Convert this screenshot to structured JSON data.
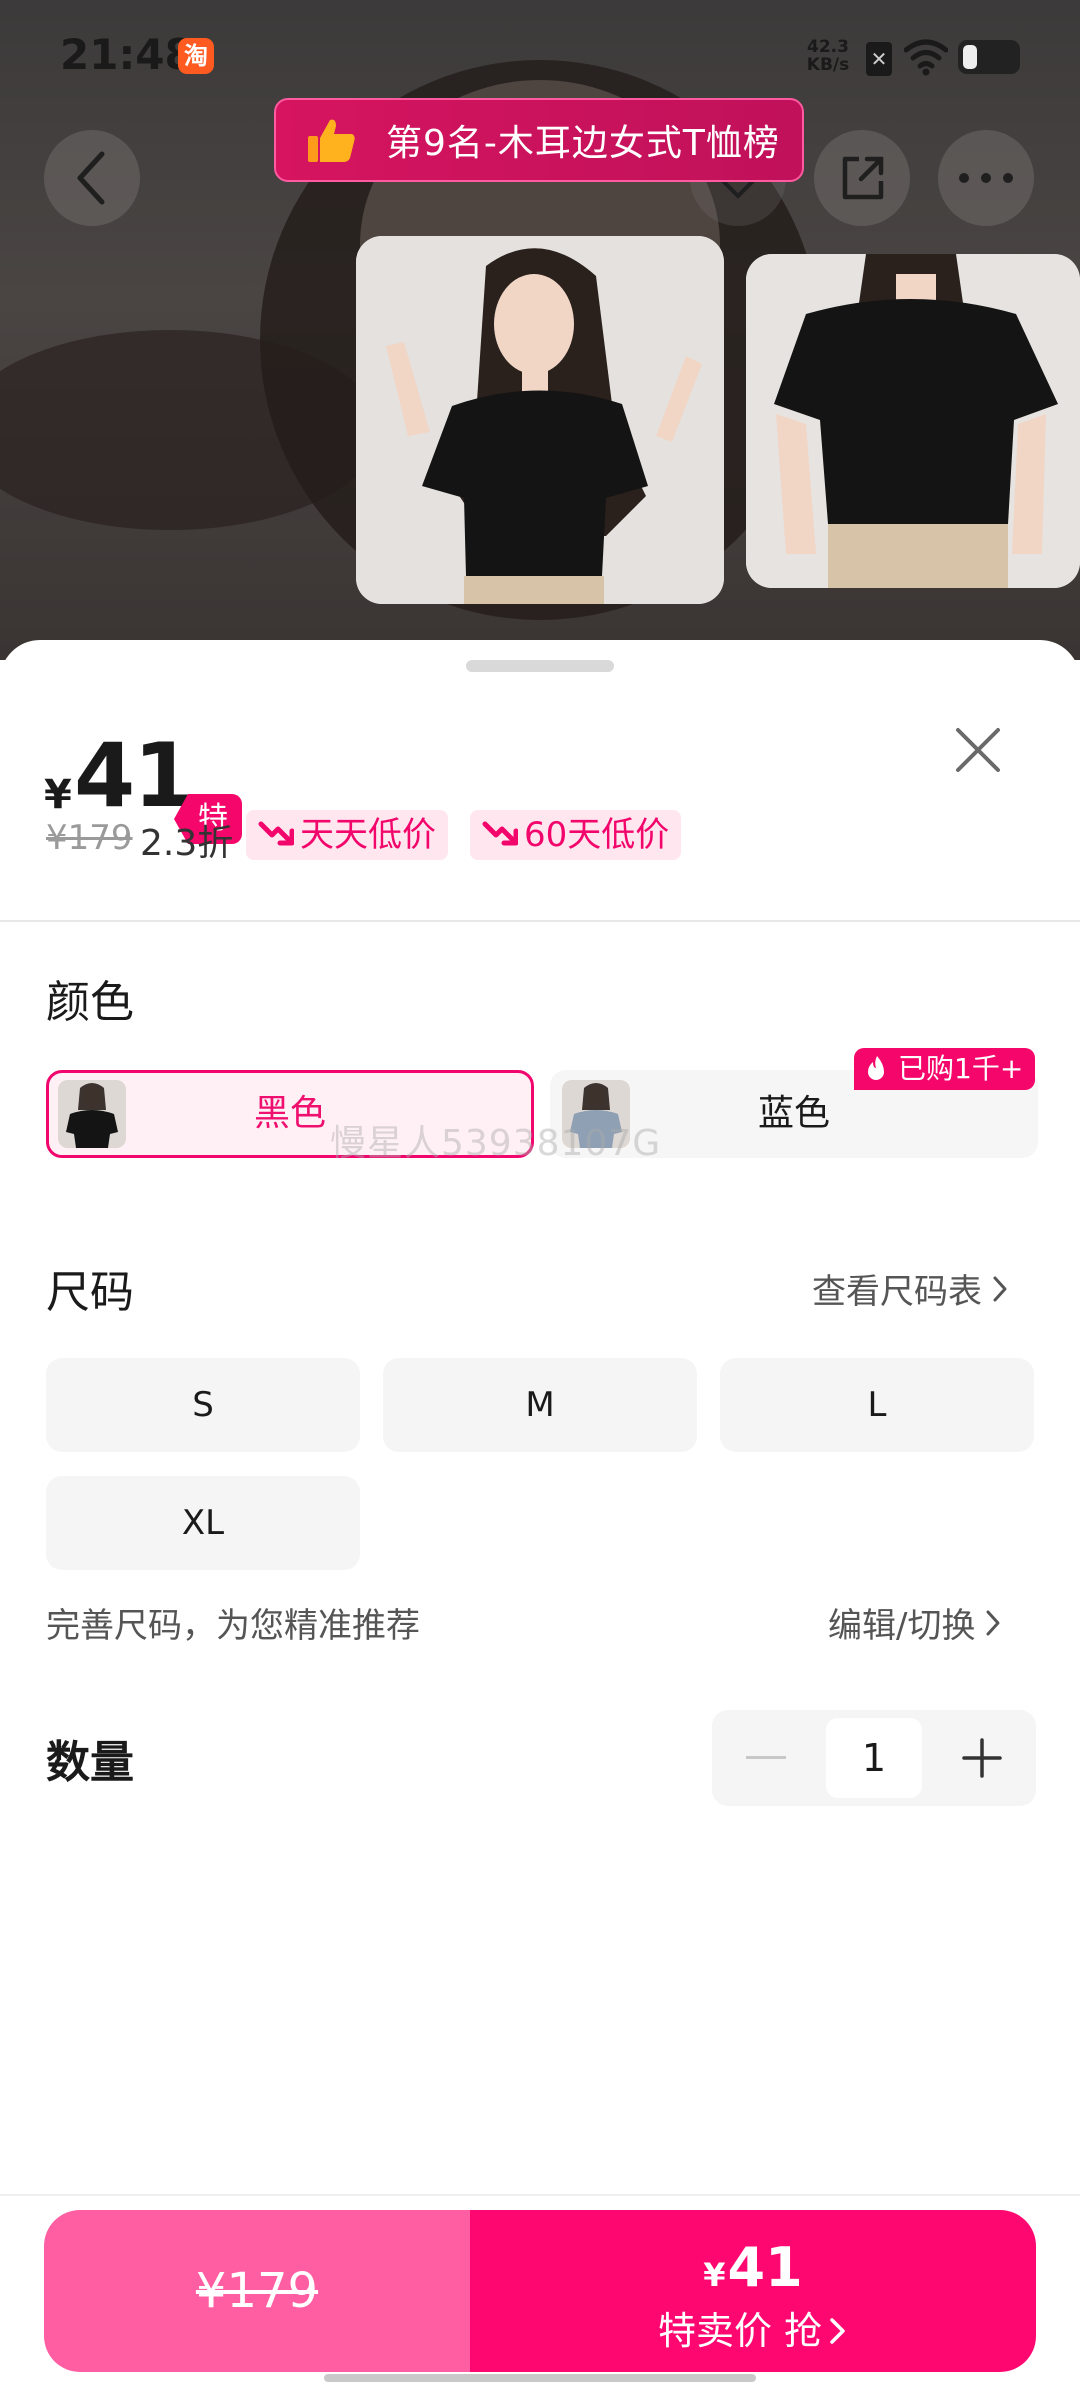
{
  "status_bar": {
    "time": "21:48",
    "app_icon_glyph": "淘",
    "net_speed_value": "42.3",
    "net_speed_unit": "KB/s"
  },
  "rank_banner": {
    "icon": "thumbs-up-icon",
    "text": "第9名-木耳边女式T恤榜"
  },
  "price": {
    "currency": "¥",
    "current": "41",
    "tag": "特卖价",
    "original": "¥179",
    "discount": "2.3折",
    "badges": [
      "天天低价",
      "60天低价"
    ]
  },
  "color_section": {
    "title": "颜色",
    "options": [
      {
        "name": "黑色",
        "selected": true
      },
      {
        "name": "蓝色",
        "selected": false
      }
    ],
    "hot_badge": "已购1千+",
    "watermark": "慢星人53938107G"
  },
  "size_section": {
    "title": "尺码",
    "chart_link": "查看尺码表",
    "sizes": [
      "S",
      "M",
      "L",
      "XL"
    ],
    "tip": "完善尺码，为您精准推荐",
    "edit_link": "编辑/切换"
  },
  "quantity_section": {
    "title": "数量",
    "value": "1"
  },
  "buy_bar": {
    "original_price": "¥179",
    "currency": "¥",
    "price": "41",
    "label": "特卖价 抢"
  },
  "colors": {
    "accent": "#f5066a",
    "accent_light": "#ff5fa2",
    "badge_bg": "#ffe6ef"
  }
}
